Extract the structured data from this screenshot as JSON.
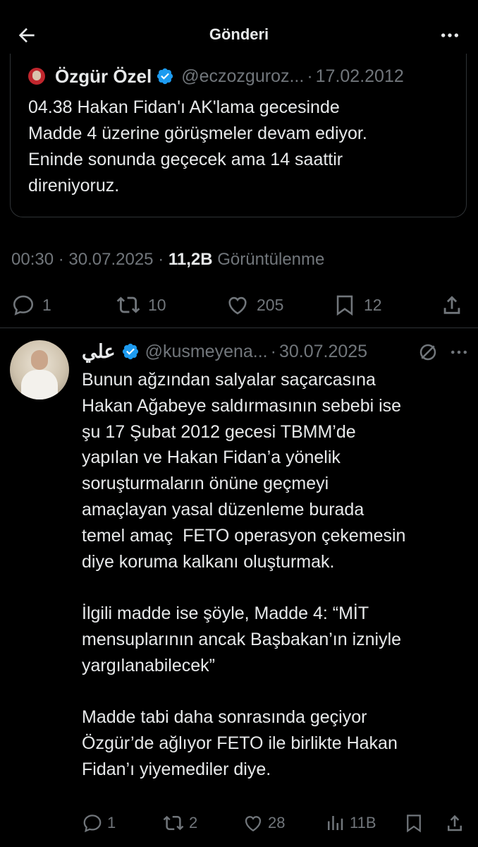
{
  "header": {
    "title": "Gönderi",
    "back_icon": "arrow-left-icon",
    "more_icon": "more-horizontal-icon"
  },
  "quoted": {
    "name": "Özgür Özel",
    "handle": "@eczozguroz...",
    "separator": "·",
    "date": "17.02.2012",
    "lines": [
      "04.38 Hakan Fidan'ı AK'lama gecesinde",
      "Madde 4 üzerine görüşmeler devam ediyor.",
      "Eninde sonunda geçecek ama 14 saattir",
      "direniyoruz."
    ]
  },
  "post": {
    "time": "00:30",
    "sep1": "·",
    "date": "30.07.2025",
    "sep2": "·",
    "views_count": "11,2B",
    "views_label": "Görüntülenme",
    "actions": {
      "replies": "1",
      "reposts": "10",
      "likes": "205",
      "bookmarks": "12"
    }
  },
  "reply": {
    "name": "علي",
    "handle": "@kusmeyena...",
    "separator": "·",
    "date": "30.07.2025",
    "lines": [
      "Bunun ağzından salyalar saçarcasına",
      "Hakan Ağabeye saldırmasının sebebi ise",
      "şu 17 Şubat 2012 gecesi TBMM’de",
      "yapılan ve Hakan Fidan’a yönelik",
      "soruşturmaların önüne geçmeyi",
      "amaçlayan yasal düzenleme burada",
      "temel amaç  FETO operasyon çekemesin",
      "diye koruma kalkanı oluşturmak.",
      "",
      "İlgili madde ise şöyle, Madde 4: “MİT",
      "mensuplarının ancak Başbakan’ın izniyle",
      "yargılanabilecek”",
      "",
      "Madde tabi daha sonrasında geçiyor",
      "Özgür’de ağlıyor FETO ile birlikte Hakan",
      "Fidan’ı yiyemediler diye."
    ],
    "actions": {
      "replies": "1",
      "reposts": "2",
      "likes": "28",
      "views": "11B"
    }
  },
  "colors": {
    "background": "#000000",
    "text": "#e7e9ea",
    "muted": "#71767b",
    "verified": "#1d9bf0",
    "border": "#2f3336"
  }
}
